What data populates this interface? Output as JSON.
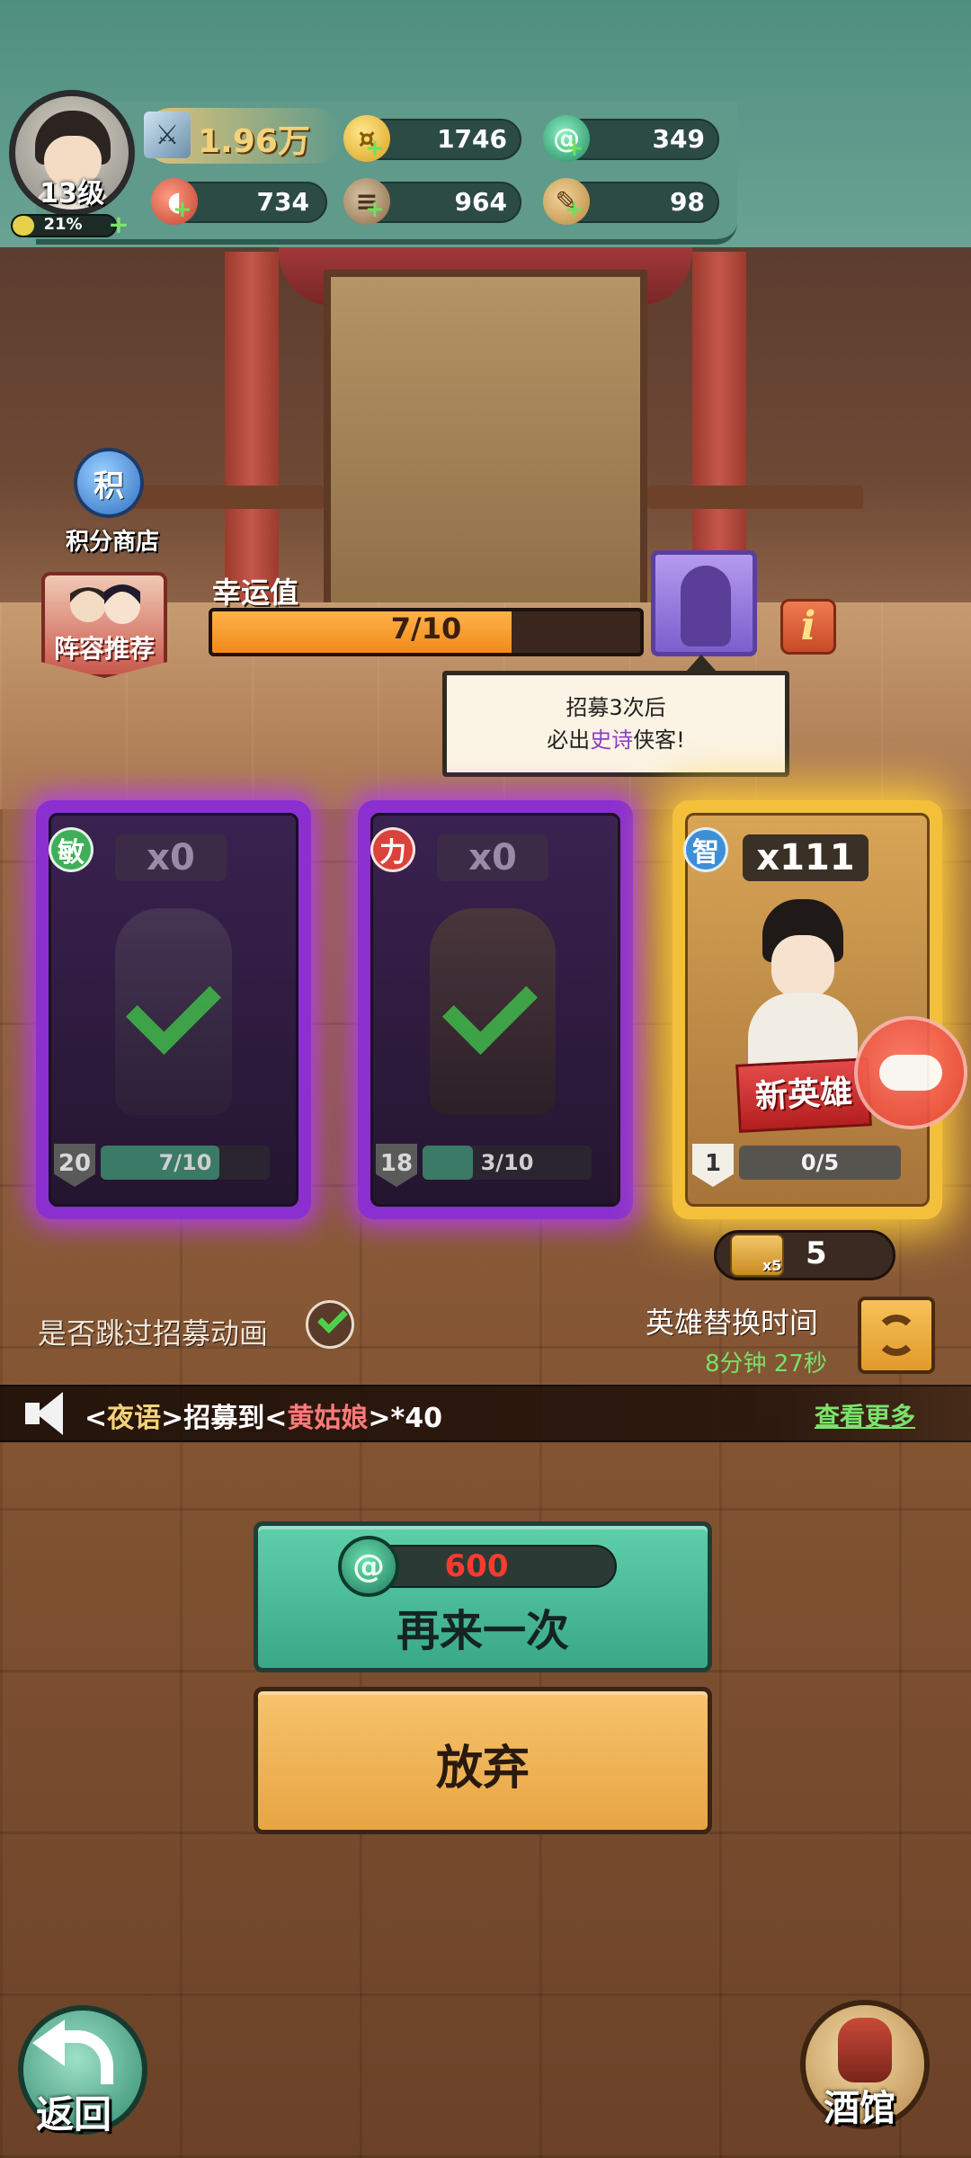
{
  "player": {
    "level_label": "13级",
    "exp_percent": 21,
    "exp_label": "21%"
  },
  "resources": {
    "power": "1.96万",
    "coins": "1746",
    "jade": "349",
    "meat": "734",
    "wood": "964",
    "scroll": "98"
  },
  "side_buttons": {
    "points_shop_icon_text": "积",
    "points_shop_label": "积分商店",
    "lineup_label": "阵容推荐"
  },
  "luck": {
    "title": "幸运值",
    "value": 7,
    "max": 10,
    "label": "7/10",
    "info_icon": "i"
  },
  "tooltip": {
    "line1": "招募3次后",
    "line2_prefix": "必出",
    "line2_highlight": "史诗",
    "line2_suffix": "侠客!"
  },
  "cards": [
    {
      "attr": "敏",
      "attr_color": "#3fae5a",
      "count": "x0",
      "level": "20",
      "progress_label": "7/10",
      "progress": 0.7,
      "rarity": "epic"
    },
    {
      "attr": "力",
      "attr_color": "#d9433b",
      "count": "x0",
      "level": "18",
      "progress_label": "3/10",
      "progress": 0.3,
      "rarity": "epic"
    },
    {
      "attr": "智",
      "attr_color": "#3d8fd6",
      "count": "x111",
      "level": "1",
      "progress_label": "0/5",
      "progress": 0,
      "rarity": "legendary",
      "badge": "新英雄"
    }
  ],
  "ticket": {
    "multiplier": "x5",
    "count": "5"
  },
  "skip": {
    "label": "是否跳过招募动画",
    "checked": true
  },
  "swap": {
    "title": "英雄替换时间",
    "time": "8分钟  27秒"
  },
  "broadcast": {
    "prefix_open": "<",
    "player": "夜语",
    "mid": ">招募到<",
    "hero": "黄姑娘",
    "suffix": ">*40",
    "more": "查看更多"
  },
  "actions": {
    "retry_cost": "600",
    "retry_label": "再来一次",
    "giveup_label": "放弃"
  },
  "nav": {
    "back_label": "返回",
    "tavern_label": "酒馆"
  },
  "colors": {
    "accent_green": "#5fcfab",
    "accent_orange": "#f7c36c",
    "luck_fill": "#f18a1a",
    "epic_purple": "#8b3fc7",
    "legendary_gold": "#f4c03c"
  },
  "icons": {
    "power": "sword-icon",
    "coins": "coin-icon",
    "jade": "jade-icon",
    "meat": "meat-icon",
    "wood": "wood-icon",
    "scroll": "scroll-icon"
  }
}
